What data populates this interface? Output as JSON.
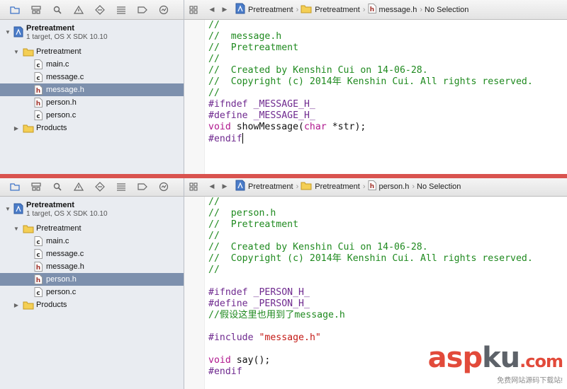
{
  "colors": {
    "selection": "#7d90ad",
    "divider": "#d9534f",
    "comment": "#1f8a1f",
    "preprocessor": "#6f2a8f",
    "keyword": "#b0188e",
    "string": "#c41a16"
  },
  "navigator_icons": [
    "folder-icon",
    "hierarchy-icon",
    "search-icon",
    "warning-icon",
    "diamond-icon",
    "list-icon",
    "tag-icon",
    "log-icon"
  ],
  "panes": [
    {
      "project": {
        "name": "Pretreatment",
        "subtitle": "1 target, OS X SDK 10.10"
      },
      "group": "Pretreatment",
      "files": [
        "main.c",
        "message.c",
        "message.h",
        "person.h",
        "person.c"
      ],
      "file_types": [
        "c",
        "c",
        "h",
        "h",
        "c"
      ],
      "selected": "message.h",
      "products": "Products",
      "jump": [
        "Pretreatment",
        "Pretreatment",
        "message.h",
        "No Selection"
      ],
      "code": [
        "//",
        "//  message.h",
        "//  Pretreatment",
        "//",
        "//  Created by Kenshin Cui on 14-06-28.",
        "//  Copyright (c) 2014年 Kenshin Cui. All rights reserved.",
        "//",
        "#ifndef _MESSAGE_H_",
        "#define _MESSAGE_H_",
        "void showMessage(char *str);",
        "#endif"
      ]
    },
    {
      "project": {
        "name": "Pretreatment",
        "subtitle": "1 target, OS X SDK 10.10"
      },
      "group": "Pretreatment",
      "files": [
        "main.c",
        "message.c",
        "message.h",
        "person.h",
        "person.c"
      ],
      "file_types": [
        "c",
        "c",
        "h",
        "h",
        "c"
      ],
      "selected": "person.h",
      "products": "Products",
      "jump": [
        "Pretreatment",
        "Pretreatment",
        "person.h",
        "No Selection"
      ],
      "code": [
        "//",
        "//  person.h",
        "//  Pretreatment",
        "//",
        "//  Created by Kenshin Cui on 14-06-28.",
        "//  Copyright (c) 2014年 Kenshin Cui. All rights reserved.",
        "//",
        "",
        "#ifndef _PERSON_H_",
        "#define _PERSON_H_",
        "//假设这里也用到了message.h",
        "",
        "#include \"message.h\"",
        "",
        "void say();",
        "#endif"
      ]
    }
  ],
  "watermark": {
    "brand_a": "asp",
    "brand_b": "ku",
    "brand_c": ".com",
    "tagline": "免费网站源码下载站!"
  }
}
